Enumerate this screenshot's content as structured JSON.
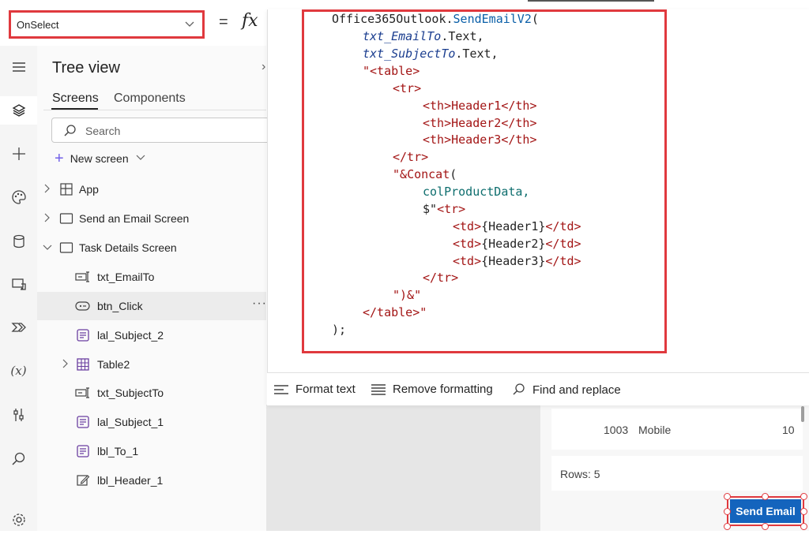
{
  "formula_bar": {
    "property": "OnSelect",
    "equals": "=",
    "fx": "fx"
  },
  "tree_view": {
    "title": "Tree view",
    "close": "›",
    "tabs": [
      "Screens",
      "Components"
    ],
    "search_placeholder": "Search",
    "new_screen": "New screen",
    "items": [
      {
        "label": "App",
        "icon": "app-icon"
      },
      {
        "label": "Send an Email Screen",
        "icon": "screen-icon"
      },
      {
        "label": "Task Details Screen",
        "icon": "screen-icon"
      },
      {
        "label": "txt_EmailTo",
        "icon": "text-input-icon"
      },
      {
        "label": "btn_Click",
        "icon": "button-icon",
        "more": "···"
      },
      {
        "label": "lal_Subject_2",
        "icon": "label-icon"
      },
      {
        "label": "Table2",
        "icon": "table-icon"
      },
      {
        "label": "txt_SubjectTo",
        "icon": "text-input-icon"
      },
      {
        "label": "lal_Subject_1",
        "icon": "label-icon"
      },
      {
        "label": "lbl_To_1",
        "icon": "label-icon"
      },
      {
        "label": "lbl_Header_1",
        "icon": "edit-label-icon"
      }
    ]
  },
  "code": {
    "l1a": "Office365Outlook.",
    "l1b": "SendEmailV2",
    "l1c": "(",
    "l2a": "txt_EmailTo",
    "l2b": ".Text,",
    "l3a": "txt_SubjectTo",
    "l3b": ".Text,",
    "l4": "\"<table>",
    "l5": "<tr>",
    "l6": "<th>Header1</th>",
    "l7": "<th>Header2</th>",
    "l8": "<th>Header3</th>",
    "l9": "</tr>",
    "l10a": "\"&",
    "l10b": "Concat",
    "l10c": "(",
    "l11": "colProductData,",
    "l12a": "$\"",
    "l12b": "<tr>",
    "l13a": "<td>",
    "l13b": "{Header1}",
    "l13c": "</td>",
    "l14a": "<td>",
    "l14b": "{Header2}",
    "l14c": "</td>",
    "l15a": "<td>",
    "l15b": "{Header3}",
    "l15c": "</td>",
    "l16": "</tr>",
    "l17": "\")&\"",
    "l18": "</table>\"",
    "l19": ");"
  },
  "editor_toolbar": {
    "format_text": "Format text",
    "remove_formatting": "Remove formatting",
    "find_replace": "Find and replace"
  },
  "canvas": {
    "gallery_row": {
      "id": "1003",
      "name": "Mobile",
      "qty": "10"
    },
    "rows_label": "Rows: 5",
    "send_button": "Send Email"
  },
  "colors": {
    "highlight": "#e0393e",
    "button": "#1464bd",
    "accent": "#7160e8"
  }
}
